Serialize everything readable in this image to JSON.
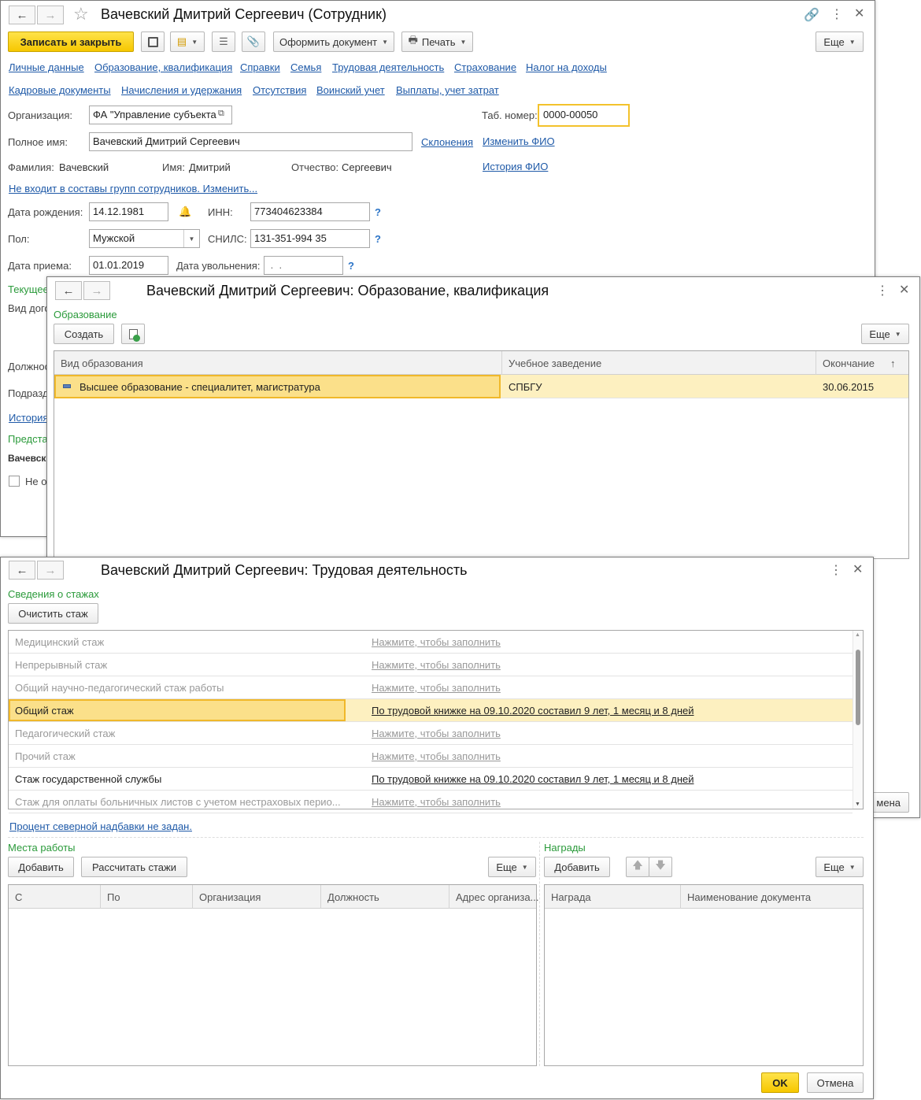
{
  "employee_window": {
    "title": "Вачевский Дмитрий Сергеевич (Сотрудник)",
    "toolbar": {
      "save_close": "Записать и закрыть",
      "issue_document": "Оформить документ",
      "print": "Печать",
      "more": "Еще"
    },
    "links_row1": [
      "Личные данные",
      "Образование, квалификация",
      "Справки",
      "Семья",
      "Трудовая деятельность",
      "Страхование",
      "Налог на доходы"
    ],
    "links_row2": [
      "Кадровые документы",
      "Начисления и удержания",
      "Отсутствия",
      "Воинский учет",
      "Выплаты, учет затрат"
    ],
    "org_label": "Организация:",
    "org_value": "ФА \"Управление субъекта",
    "tab_label": "Таб. номер:",
    "tab_value": "0000-00050",
    "fullname_label": "Полное имя:",
    "fullname_value": "Вачевский Дмитрий Сергеевич",
    "declension_link": "Склонения",
    "change_fio_link": "Изменить ФИО",
    "history_fio_link": "История ФИО",
    "surname_label": "Фамилия:",
    "surname_value": "Вачевский",
    "name_label": "Имя:",
    "name_value": "Дмитрий",
    "patronymic_label": "Отчество:",
    "patronymic_value": "Сергеевич",
    "groups_link": "Не входит в составы групп сотрудников. Изменить...",
    "birth_label": "Дата рождения:",
    "birth_value": "14.12.1981",
    "inn_label": "ИНН:",
    "inn_value": "773404623384",
    "gender_label": "Пол:",
    "gender_value": "Мужской",
    "snils_label": "СНИЛС:",
    "snils_value": "131-351-994 35",
    "hire_label": "Дата приема:",
    "hire_value": "01.01.2019",
    "dismiss_label": "Дата увольнения:",
    "dismiss_value": " .  .",
    "question": "?",
    "partial": {
      "current": "Текущее",
      "contract_type": "Вид дого",
      "position": "Должнос",
      "department": "Подразд",
      "history": "История",
      "representation": "Предста",
      "vachevsk": "Вачевск",
      "not_checkbox": "Не о"
    }
  },
  "education_window": {
    "title": "Вачевский Дмитрий Сергеевич: Образование, квалификация",
    "section": "Образование",
    "create": "Создать",
    "more": "Еще",
    "columns": [
      "Вид образования",
      "Учебное заведение",
      "Окончание"
    ],
    "sort_glyph": "↑",
    "rows": [
      {
        "kind": "Высшее образование - специалитет, магистратура",
        "institution": "СПБГУ",
        "end": "30.06.2015"
      }
    ]
  },
  "labor_window": {
    "title": "Вачевский Дмитрий Сергеевич: Трудовая деятельность",
    "section": "Сведения о стажах",
    "clear_button": "Очистить стаж",
    "stazh_rows": [
      {
        "name": "Медицинский стаж",
        "value": "Нажмите, чтобы заполнить",
        "filled": false
      },
      {
        "name": "Непрерывный стаж",
        "value": "Нажмите, чтобы заполнить",
        "filled": false
      },
      {
        "name": "Общий научно-педагогический стаж работы",
        "value": "Нажмите, чтобы заполнить",
        "filled": false
      },
      {
        "name": "Общий стаж",
        "value": "По трудовой книжке на 09.10.2020 составил 9 лет, 1 месяц и 8 дней",
        "filled": true
      },
      {
        "name": "Педагогический стаж",
        "value": "Нажмите, чтобы заполнить",
        "filled": false
      },
      {
        "name": "Прочий стаж",
        "value": "Нажмите, чтобы заполнить",
        "filled": false
      },
      {
        "name": "Стаж государственной службы",
        "value": "По трудовой книжке на 09.10.2020 составил 9 лет, 1 месяц и 8 дней",
        "filled": true
      },
      {
        "name": "Стаж для оплаты больничных листов с учетом нестраховых перио...",
        "value": "Нажмите, чтобы заполнить",
        "filled": false
      }
    ],
    "north_link": "Процент северной надбавки не задан.",
    "workplaces": {
      "section": "Места работы",
      "add": "Добавить",
      "calc": "Рассчитать стажи",
      "more": "Еще",
      "columns": [
        "С",
        "По",
        "Организация",
        "Должность",
        "Адрес организа..."
      ]
    },
    "awards": {
      "section": "Награды",
      "add": "Добавить",
      "more": "Еще",
      "columns": [
        "Награда",
        "Наименование документа"
      ]
    },
    "ok": "OK",
    "cancel": "Отмена",
    "behind_cancel_fragment": "мена"
  }
}
